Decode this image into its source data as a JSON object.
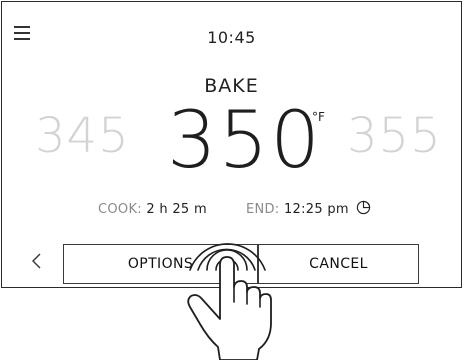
{
  "header": {
    "time": "10:45",
    "menu_icon": "hamburger-menu-icon"
  },
  "mode": {
    "label": "BAKE"
  },
  "temperature": {
    "previous": "345",
    "current": "350",
    "next": "355",
    "unit": "°F"
  },
  "status": {
    "cook_label": "COOK:",
    "cook_value": "2 h 25 m",
    "end_label": "END:",
    "end_value": "12:25 pm",
    "timer_icon": "timer-icon"
  },
  "buttons": {
    "back_icon": "chevron-left-icon",
    "options_label": "OPTIONS",
    "cancel_label": "CANCEL"
  },
  "overlay": {
    "gesture_icon": "hand-tap-icon"
  }
}
